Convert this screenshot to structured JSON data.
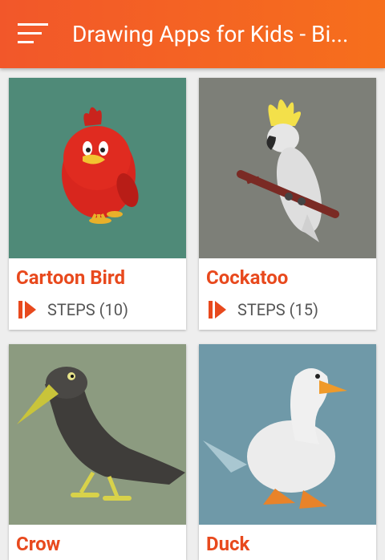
{
  "app_bar": {
    "title": "Drawing Apps for Kids - Bi...",
    "menu_icon": "hamburger-menu-icon",
    "color_start": "#f2572a",
    "color_end": "#f66f1c"
  },
  "cards": [
    {
      "title": "Cartoon Bird",
      "steps_label": "STEPS (10)",
      "thumb_bg": "#4f8a78"
    },
    {
      "title": "Cockatoo",
      "steps_label": "STEPS (15)",
      "thumb_bg": "#7d7f78"
    },
    {
      "title": "Crow",
      "steps_label": "",
      "thumb_bg": "#8c9b80"
    },
    {
      "title": "Duck",
      "steps_label": "",
      "thumb_bg": "#6f99a8"
    }
  ],
  "colors": {
    "accent": "#e8491d",
    "background": "#eeeeee",
    "card": "#ffffff"
  },
  "icons": {
    "steps": "play-steps-icon"
  }
}
